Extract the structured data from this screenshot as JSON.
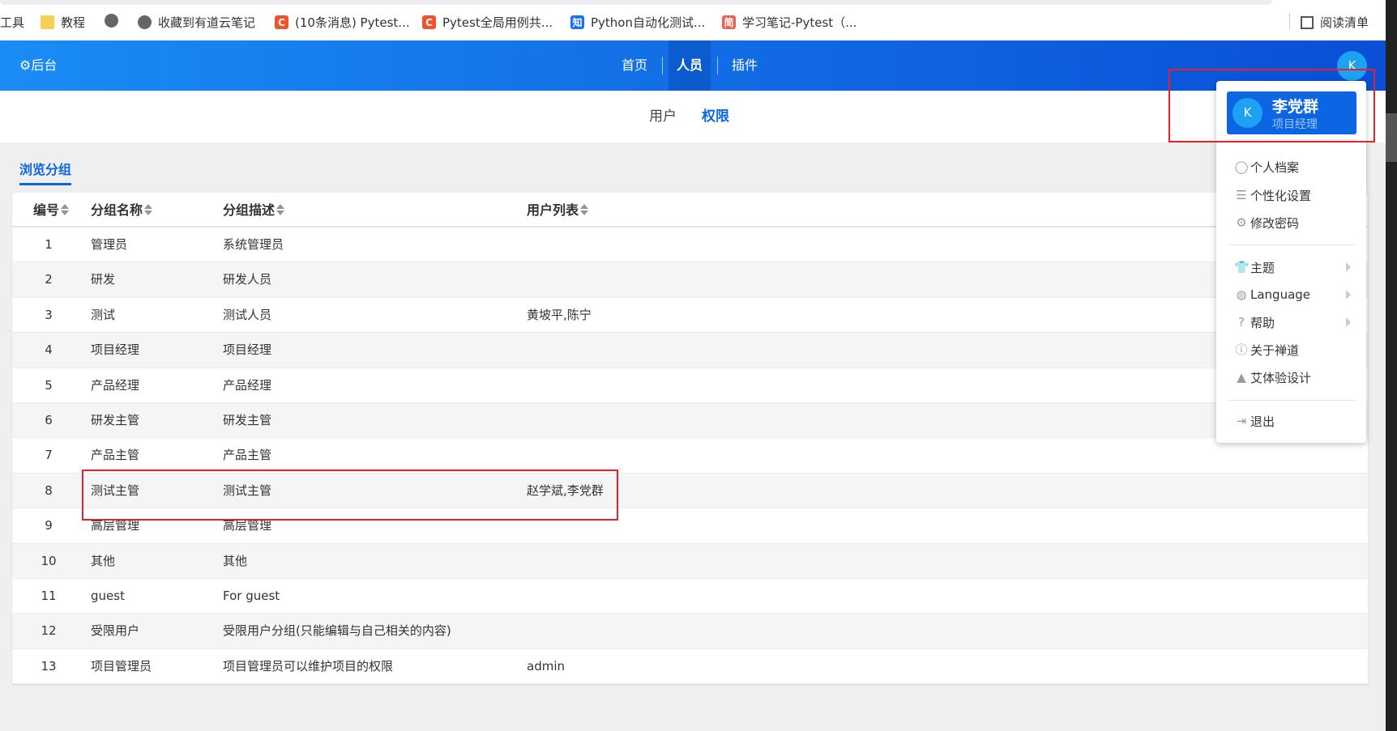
{
  "bookmarks": {
    "items": [
      {
        "label": "工具",
        "icon": "none"
      },
      {
        "label": "教程",
        "icon": "folder-icon"
      },
      {
        "label": "",
        "icon": "globe-icon"
      },
      {
        "label": "收藏到有道云笔记",
        "icon": "globe-icon"
      },
      {
        "label": "(10条消息) Pytest...",
        "icon": "C"
      },
      {
        "label": "Pytest全局用例共...",
        "icon": "C"
      },
      {
        "label": "Python自动化测试...",
        "icon": "知"
      },
      {
        "label": "学习笔记-Pytest（...",
        "icon": "简"
      }
    ],
    "reading_list": "阅读清单"
  },
  "header": {
    "brand": "后台",
    "nav": [
      "首页",
      "人员",
      "插件"
    ],
    "active_nav": "人员",
    "avatar": "K"
  },
  "subnav": {
    "tabs": [
      "用户",
      "权限"
    ],
    "active": "权限"
  },
  "section_tab": "浏览分组",
  "table": {
    "columns": [
      "编号",
      "分组名称",
      "分组描述",
      "用户列表"
    ],
    "rows": [
      [
        "1",
        "管理员",
        "系统管理员",
        ""
      ],
      [
        "2",
        "研发",
        "研发人员",
        ""
      ],
      [
        "3",
        "测试",
        "测试人员",
        "黄坡平,陈宁"
      ],
      [
        "4",
        "项目经理",
        "项目经理",
        ""
      ],
      [
        "5",
        "产品经理",
        "产品经理",
        ""
      ],
      [
        "6",
        "研发主管",
        "研发主管",
        ""
      ],
      [
        "7",
        "产品主管",
        "产品主管",
        ""
      ],
      [
        "8",
        "测试主管",
        "测试主管",
        "赵学斌,李党群"
      ],
      [
        "9",
        "高层管理",
        "高层管理",
        ""
      ],
      [
        "10",
        "其他",
        "其他",
        ""
      ],
      [
        "11",
        "guest",
        "For guest",
        ""
      ],
      [
        "12",
        "受限用户",
        "受限用户分组(只能编辑与自己相关的内容)",
        ""
      ],
      [
        "13",
        "项目管理员",
        "项目管理员可以维护项目的权限",
        "admin"
      ]
    ]
  },
  "user_menu": {
    "avatar": "K",
    "name": "李党群",
    "role": "项目经理",
    "items": [
      {
        "label": "个人档案",
        "icon": "user-circle-icon"
      },
      {
        "label": "个性化设置",
        "icon": "sliders-icon"
      },
      {
        "label": "修改密码",
        "icon": "gear-icon"
      },
      {
        "label": "主题",
        "icon": "tshirt-icon",
        "submenu": true
      },
      {
        "label": "Language",
        "icon": "globe-icon",
        "submenu": true
      },
      {
        "label": "帮助",
        "icon": "help-icon",
        "submenu": true
      },
      {
        "label": "关于禅道",
        "icon": "info-icon"
      },
      {
        "label": "艾体验设计",
        "icon": "a-logo-icon"
      },
      {
        "label": "退出",
        "icon": "logout-icon"
      }
    ]
  },
  "colors": {
    "primary": "#0c66e4",
    "header_start": "#1a8cf5",
    "header_end": "#0a4fd6",
    "highlight": "#e8202a"
  }
}
